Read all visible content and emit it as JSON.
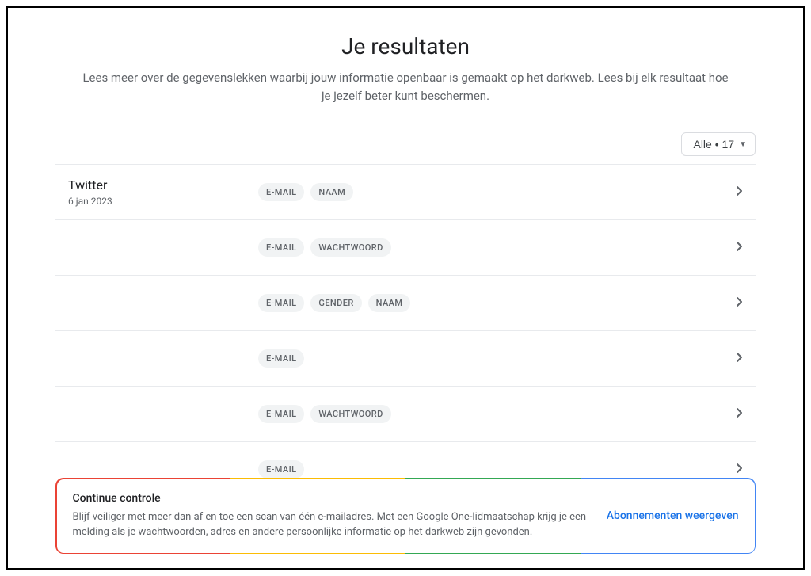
{
  "header": {
    "title": "Je resultaten",
    "subtitle": "Lees meer over de gegevenslekken waarbij jouw informatie openbaar is gemaakt op het darkweb. Lees bij elk resultaat hoe je jezelf beter kunt beschermen."
  },
  "filter": {
    "label": "Alle • 17"
  },
  "results": [
    {
      "name": "Twitter",
      "date": "6 jan 2023",
      "show": true,
      "tags": [
        "E-MAIL",
        "NAAM"
      ]
    },
    {
      "name": "",
      "date": "",
      "show": false,
      "tags": [
        "E-MAIL",
        "WACHTWOORD"
      ]
    },
    {
      "name": "",
      "date": "",
      "show": false,
      "tags": [
        "E-MAIL",
        "GENDER",
        "NAAM"
      ]
    },
    {
      "name": "",
      "date": "",
      "show": false,
      "tags": [
        "E-MAIL"
      ]
    },
    {
      "name": "",
      "date": "",
      "show": false,
      "tags": [
        "E-MAIL",
        "WACHTWOORD"
      ]
    },
    {
      "name": "",
      "date": "",
      "show": false,
      "tags": [
        "E-MAIL"
      ]
    }
  ],
  "promo": {
    "title": "Continue controle",
    "desc": "Blijf veiliger met meer dan af en toe een scan van één e-mailadres. Met een Google One-lidmaatschap krijg je een melding als je wachtwoorden, adres en andere persoonlijke informatie op het darkweb zijn gevonden.",
    "cta": "Abonnementen weergeven"
  }
}
